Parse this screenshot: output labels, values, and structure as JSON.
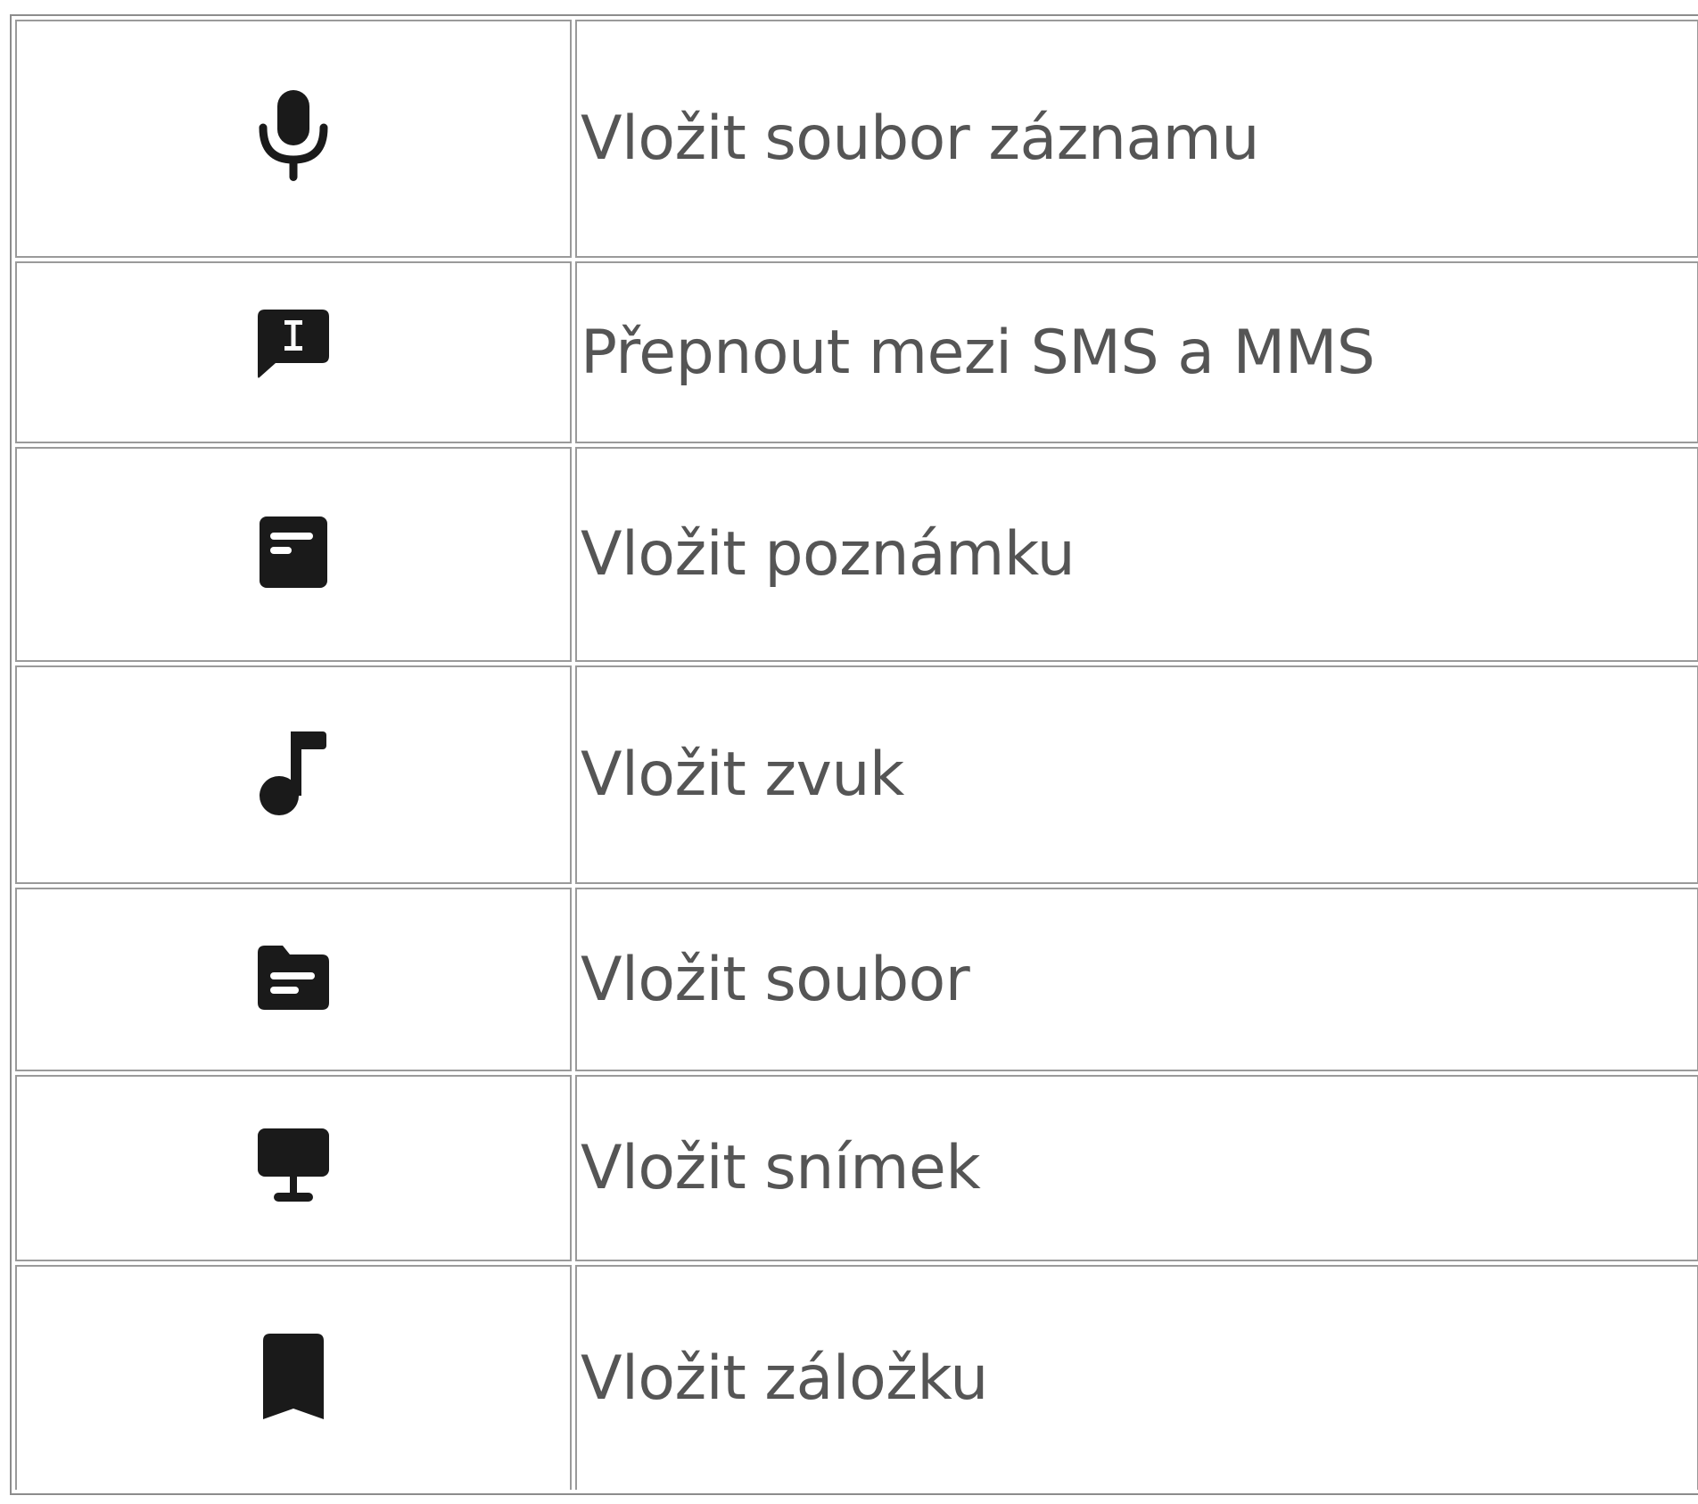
{
  "table": {
    "rows": [
      {
        "icon": "microphone-icon",
        "label": "Vložit soubor záznamu"
      },
      {
        "icon": "message-text-icon",
        "label": "Přepnout mezi SMS a MMS"
      },
      {
        "icon": "note-icon",
        "label": "Vložit poznámku"
      },
      {
        "icon": "music-note-icon",
        "label": "Vložit zvuk"
      },
      {
        "icon": "folder-file-icon",
        "label": "Vložit soubor"
      },
      {
        "icon": "slide-presentation-icon",
        "label": "Vložit snímek"
      },
      {
        "icon": "bookmark-icon",
        "label": "Vložit záložku"
      }
    ]
  },
  "colors": {
    "text": "#555555",
    "icon": "#1a1a1a",
    "border": "#9a9a9a"
  }
}
